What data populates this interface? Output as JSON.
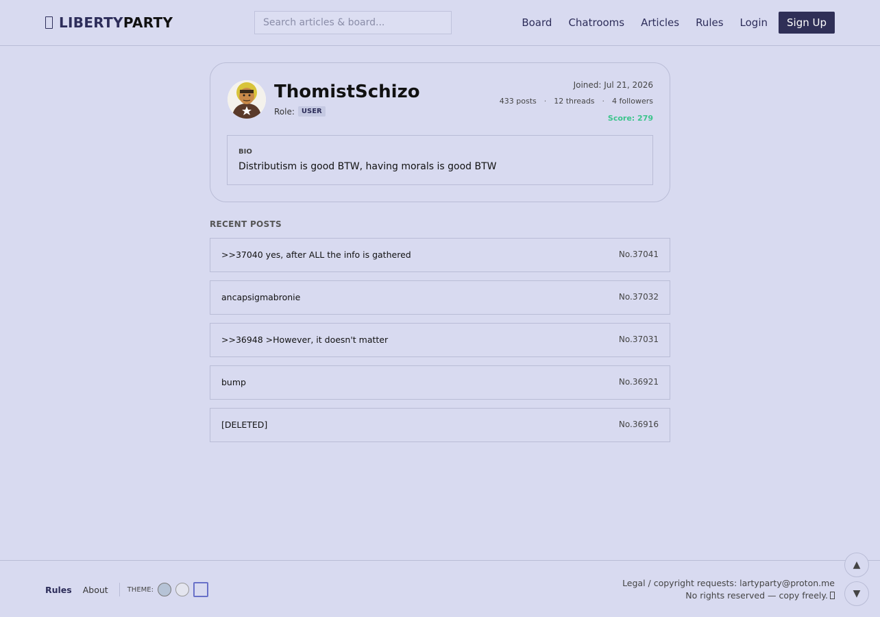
{
  "header": {
    "logo_part1": "LIBERTY",
    "logo_part2": "PARTY",
    "search_placeholder": "Search articles & board...",
    "nav": [
      "Board",
      "Chatrooms",
      "Articles",
      "Rules",
      "Login"
    ],
    "signup_label": "Sign Up"
  },
  "profile": {
    "username": "ThomistSchizo",
    "role_label": "Role:",
    "role": "USER",
    "joined": "Joined: Jul 21, 2026",
    "posts": "433 posts",
    "threads": "12 threads",
    "followers": "4 followers",
    "stat_sep": "·",
    "score": "Score: 279",
    "score_color": "#3cc48c",
    "bio_label": "BIO",
    "bio_text": "Distributism is good BTW, having morals is good BTW"
  },
  "recent": {
    "title": "RECENT POSTS",
    "items": [
      {
        "text": ">>37040 yes, after ALL the info is gathered",
        "no": "No.37041"
      },
      {
        "text": "ancapsigmabronie",
        "no": "No.37032"
      },
      {
        "text": ">>36948 >However, it doesn't matter",
        "no": "No.37031"
      },
      {
        "text": "bump",
        "no": "No.36921"
      },
      {
        "text": "[DELETED]",
        "no": "No.36916"
      }
    ]
  },
  "footer": {
    "rules": "Rules",
    "about": "About",
    "theme_label": "THEME:",
    "legal": "Legal / copyright requests: lartyparty@proton.me",
    "rights": "No rights reserved — copy freely."
  },
  "scroll": {
    "up": "▲",
    "down": "▼"
  },
  "colors": {
    "accent": "#2f2f57",
    "background": "#d8daf0"
  }
}
